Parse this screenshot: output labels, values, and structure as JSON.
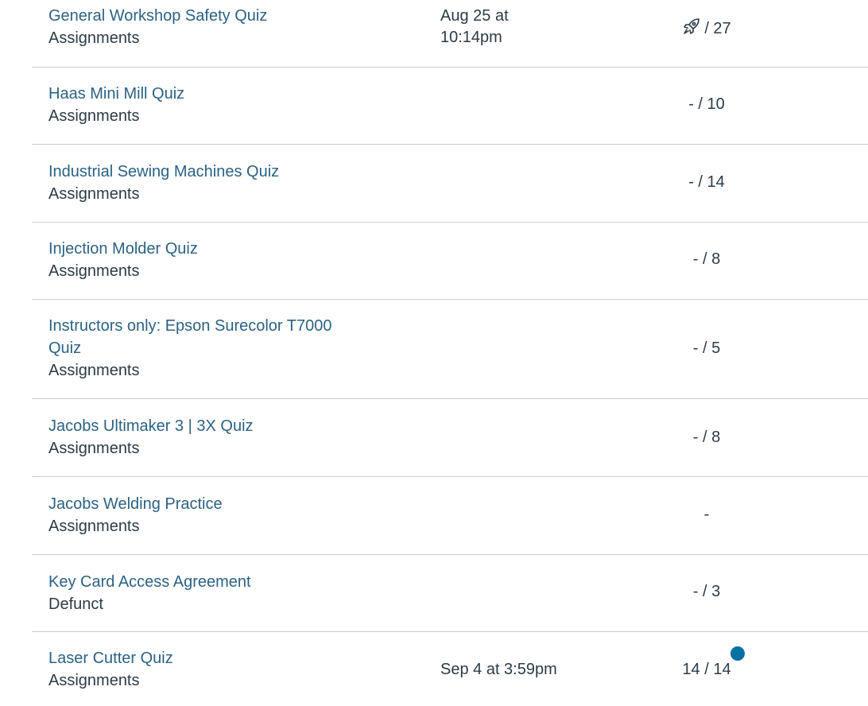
{
  "rows": [
    {
      "title": "General Workshop Safety Quiz",
      "group": "Assignments",
      "due": "Aug 25 at 10:14pm",
      "score": "/ 27",
      "icon": "rocket-icon"
    },
    {
      "title": "Haas Mini Mill Quiz",
      "group": "Assignments",
      "due": "",
      "score": "- / 10"
    },
    {
      "title": "Industrial Sewing Machines Quiz",
      "group": "Assignments",
      "due": "",
      "score": "- / 14"
    },
    {
      "title": "Injection Molder Quiz",
      "group": "Assignments",
      "due": "",
      "score": "- / 8"
    },
    {
      "title": "Instructors only: Epson Surecolor T7000 Quiz",
      "group": "Assignments",
      "due": "",
      "score": "- / 5"
    },
    {
      "title": "Jacobs Ultimaker 3 | 3X Quiz",
      "group": "Assignments",
      "due": "",
      "score": "- / 8"
    },
    {
      "title": "Jacobs Welding Practice",
      "group": "Assignments",
      "due": "",
      "score": "-"
    },
    {
      "title": "Key Card Access Agreement",
      "group": "Defunct",
      "due": "",
      "score": "- / 3"
    },
    {
      "title": "Laser Cutter Quiz",
      "group": "Assignments",
      "due": "Sep 4 at 3:59pm",
      "score": "14 / 14",
      "unread": true
    }
  ],
  "colors": {
    "link": "#2b6284",
    "text": "#2d3b45",
    "divider": "#c7cdd1",
    "unread_dot": "#0770a3"
  }
}
